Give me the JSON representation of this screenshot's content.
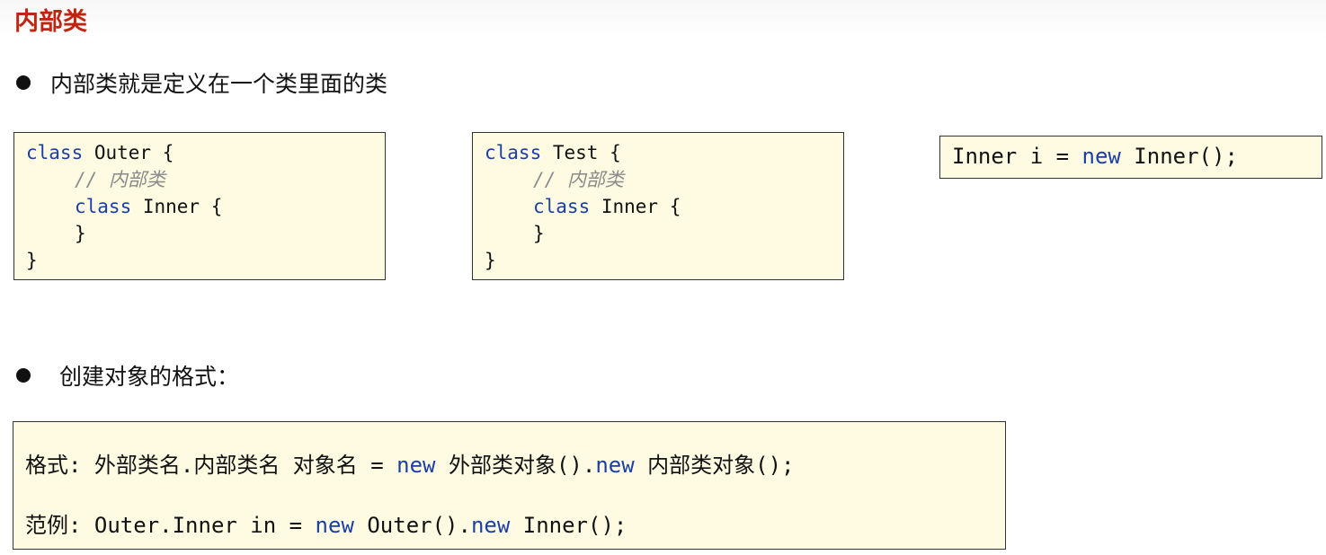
{
  "page": {
    "title": "内部类"
  },
  "bullets": {
    "definition": "内部类就是定义在一个类里面的类",
    "create_format": "创建对象的格式："
  },
  "code_outer": {
    "l1_kw": "class",
    "l1_rest": " Outer {",
    "l2_comment": "// 内部类",
    "l3_kw": "class",
    "l3_rest": " Inner {",
    "l4": "}",
    "l5": "}"
  },
  "code_test": {
    "l1_kw": "class",
    "l1_rest": " Test {",
    "l2_comment": "// 内部类",
    "l3_kw": "class",
    "l3_rest": " Inner {",
    "l4": "}",
    "l5": "}"
  },
  "code_inner": {
    "pre": "Inner i = ",
    "kw": "new",
    "post": " Inner();"
  },
  "format_box": {
    "format_pre": "格式: 外部类名.内部类名 对象名 = ",
    "format_kw1": "new",
    "format_mid": " 外部类对象().",
    "format_kw2": "new",
    "format_post": " 内部类对象();",
    "example_pre": "范例: Outer.Inner in = ",
    "example_kw1": "new",
    "example_mid": " Outer().",
    "example_kw2": "new",
    "example_post": " Inner();"
  },
  "colors": {
    "title": "#c0250f",
    "keyword": "#1a3fa6",
    "comment": "#8a8a8a",
    "code_bg": "#fefbe2"
  }
}
